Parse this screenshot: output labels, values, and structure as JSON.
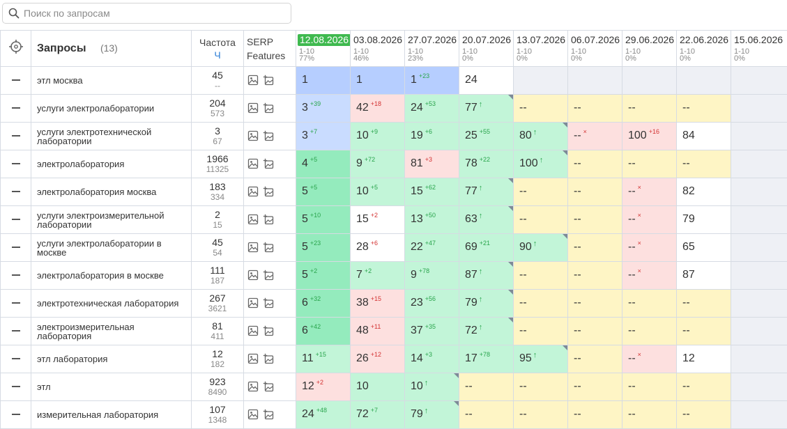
{
  "search": {
    "placeholder": "Поиск по запросам"
  },
  "header": {
    "title": "Запросы",
    "count": "(13)",
    "freq_label": "Частота",
    "freq_sub": "Ч",
    "serp_line1": "SERP",
    "serp_line2": "Features",
    "dates": [
      {
        "date": "12.08.2026",
        "range": "1-10",
        "pct": "77%",
        "active": true
      },
      {
        "date": "03.08.2026",
        "range": "1-10",
        "pct": "46%",
        "active": false
      },
      {
        "date": "27.07.2026",
        "range": "1-10",
        "pct": "23%",
        "active": false
      },
      {
        "date": "20.07.2026",
        "range": "1-10",
        "pct": "0%",
        "active": false
      },
      {
        "date": "13.07.2026",
        "range": "1-10",
        "pct": "0%",
        "active": false
      },
      {
        "date": "06.07.2026",
        "range": "1-10",
        "pct": "0%",
        "active": false
      },
      {
        "date": "29.06.2026",
        "range": "1-10",
        "pct": "0%",
        "active": false
      },
      {
        "date": "22.06.2026",
        "range": "1-10",
        "pct": "0%",
        "active": false
      },
      {
        "date": "15.06.2026",
        "range": "1-10",
        "pct": "0%",
        "active": false
      }
    ]
  },
  "colors": {
    "active_date": "#3fb94f",
    "blue": "#c9dcff",
    "green": "#c2f5d8",
    "red": "#fde0df",
    "yellow": "#fef5c5",
    "gray": "#eef0f5"
  },
  "icons": {
    "target": "crosshair-icon",
    "search": "search-icon",
    "serp1": "image-icon",
    "serp2": "images-plus-icon",
    "row_action": "minus-icon"
  },
  "rows": [
    {
      "query": "этл москва",
      "freq": "45",
      "freq2": "--",
      "cells": [
        {
          "v": "1",
          "bg": "blue2"
        },
        {
          "v": "1",
          "bg": "blue2"
        },
        {
          "v": "1",
          "d": "+23",
          "dir": "up",
          "bg": "blue2"
        },
        {
          "v": "24",
          "bg": "white"
        },
        {
          "bg": "gray"
        },
        {
          "bg": "gray"
        },
        {
          "bg": "gray"
        },
        {
          "bg": "gray"
        },
        {
          "bg": "gray"
        }
      ]
    },
    {
      "query": "услуги электролаборатории",
      "freq": "204",
      "freq2": "573",
      "cells": [
        {
          "v": "3",
          "d": "+39",
          "dir": "up",
          "bg": "blue"
        },
        {
          "v": "42",
          "d": "+18",
          "dir": "down",
          "bg": "red"
        },
        {
          "v": "24",
          "d": "+53",
          "dir": "up",
          "bg": "green"
        },
        {
          "v": "77",
          "d": "↑",
          "dir": "new",
          "bg": "green",
          "corner": true
        },
        {
          "v": "--",
          "bg": "yellow"
        },
        {
          "v": "--",
          "bg": "yellow"
        },
        {
          "v": "--",
          "bg": "yellow"
        },
        {
          "v": "--",
          "bg": "yellow"
        },
        {
          "bg": "gray"
        }
      ]
    },
    {
      "query": "услуги электротехнической лаборатории",
      "freq": "3",
      "freq2": "67",
      "cells": [
        {
          "v": "3",
          "d": "+7",
          "dir": "up",
          "bg": "blue"
        },
        {
          "v": "10",
          "d": "+9",
          "dir": "up",
          "bg": "green"
        },
        {
          "v": "19",
          "d": "+6",
          "dir": "up",
          "bg": "green"
        },
        {
          "v": "25",
          "d": "+55",
          "dir": "up",
          "bg": "green"
        },
        {
          "v": "80",
          "d": "↑",
          "dir": "new",
          "bg": "green",
          "corner": true
        },
        {
          "v": "--",
          "d": "×",
          "dir": "down",
          "bg": "red"
        },
        {
          "v": "100",
          "d": "+16",
          "dir": "down",
          "bg": "red"
        },
        {
          "v": "84",
          "bg": "white"
        },
        {
          "bg": "gray"
        }
      ]
    },
    {
      "query": "электролаборатория",
      "freq": "1966",
      "freq2": "11325",
      "cells": [
        {
          "v": "4",
          "d": "+5",
          "dir": "up",
          "bg": "green2"
        },
        {
          "v": "9",
          "d": "+72",
          "dir": "up",
          "bg": "green"
        },
        {
          "v": "81",
          "d": "+3",
          "dir": "down",
          "bg": "red"
        },
        {
          "v": "78",
          "d": "+22",
          "dir": "up",
          "bg": "green"
        },
        {
          "v": "100",
          "d": "↑",
          "dir": "new",
          "bg": "green",
          "corner": true
        },
        {
          "v": "--",
          "bg": "yellow"
        },
        {
          "v": "--",
          "bg": "yellow"
        },
        {
          "v": "--",
          "bg": "yellow"
        },
        {
          "bg": "gray"
        }
      ]
    },
    {
      "query": "электролаборатория москва",
      "freq": "183",
      "freq2": "334",
      "cells": [
        {
          "v": "5",
          "d": "+5",
          "dir": "up",
          "bg": "green2"
        },
        {
          "v": "10",
          "d": "+5",
          "dir": "up",
          "bg": "green"
        },
        {
          "v": "15",
          "d": "+62",
          "dir": "up",
          "bg": "green"
        },
        {
          "v": "77",
          "d": "↑",
          "dir": "new",
          "bg": "green",
          "corner": true
        },
        {
          "v": "--",
          "bg": "yellow"
        },
        {
          "v": "--",
          "bg": "yellow"
        },
        {
          "v": "--",
          "d": "×",
          "dir": "down",
          "bg": "red"
        },
        {
          "v": "82",
          "bg": "white"
        },
        {
          "bg": "gray"
        }
      ]
    },
    {
      "query": "услуги электроизмерительной лаборатории",
      "freq": "2",
      "freq2": "15",
      "cells": [
        {
          "v": "5",
          "d": "+10",
          "dir": "up",
          "bg": "green2"
        },
        {
          "v": "15",
          "d": "+2",
          "dir": "down",
          "bg": "white"
        },
        {
          "v": "13",
          "d": "+50",
          "dir": "up",
          "bg": "green"
        },
        {
          "v": "63",
          "d": "↑",
          "dir": "new",
          "bg": "green",
          "corner": true
        },
        {
          "v": "--",
          "bg": "yellow"
        },
        {
          "v": "--",
          "bg": "yellow"
        },
        {
          "v": "--",
          "d": "×",
          "dir": "down",
          "bg": "red"
        },
        {
          "v": "79",
          "bg": "white"
        },
        {
          "bg": "gray"
        }
      ]
    },
    {
      "query": "услуги электролаборатории в москве",
      "freq": "45",
      "freq2": "54",
      "cells": [
        {
          "v": "5",
          "d": "+23",
          "dir": "up",
          "bg": "green2"
        },
        {
          "v": "28",
          "d": "+6",
          "dir": "down",
          "bg": "white"
        },
        {
          "v": "22",
          "d": "+47",
          "dir": "up",
          "bg": "green"
        },
        {
          "v": "69",
          "d": "+21",
          "dir": "up",
          "bg": "green"
        },
        {
          "v": "90",
          "d": "↑",
          "dir": "new",
          "bg": "green",
          "corner": true
        },
        {
          "v": "--",
          "bg": "yellow"
        },
        {
          "v": "--",
          "d": "×",
          "dir": "down",
          "bg": "red"
        },
        {
          "v": "65",
          "bg": "white"
        },
        {
          "bg": "gray"
        }
      ]
    },
    {
      "query": "электролаборатория в москве",
      "freq": "111",
      "freq2": "187",
      "cells": [
        {
          "v": "5",
          "d": "+2",
          "dir": "up",
          "bg": "green2"
        },
        {
          "v": "7",
          "d": "+2",
          "dir": "up",
          "bg": "green"
        },
        {
          "v": "9",
          "d": "+78",
          "dir": "up",
          "bg": "green"
        },
        {
          "v": "87",
          "d": "↑",
          "dir": "new",
          "bg": "green",
          "corner": true
        },
        {
          "v": "--",
          "bg": "yellow"
        },
        {
          "v": "--",
          "bg": "yellow"
        },
        {
          "v": "--",
          "d": "×",
          "dir": "down",
          "bg": "red"
        },
        {
          "v": "87",
          "bg": "white"
        },
        {
          "bg": "gray"
        }
      ]
    },
    {
      "query": "электротехническая лаборатория",
      "freq": "267",
      "freq2": "3621",
      "cells": [
        {
          "v": "6",
          "d": "+32",
          "dir": "up",
          "bg": "green2"
        },
        {
          "v": "38",
          "d": "+15",
          "dir": "down",
          "bg": "red"
        },
        {
          "v": "23",
          "d": "+56",
          "dir": "up",
          "bg": "green"
        },
        {
          "v": "79",
          "d": "↑",
          "dir": "new",
          "bg": "green",
          "corner": true
        },
        {
          "v": "--",
          "bg": "yellow"
        },
        {
          "v": "--",
          "bg": "yellow"
        },
        {
          "v": "--",
          "bg": "yellow"
        },
        {
          "v": "--",
          "bg": "yellow"
        },
        {
          "bg": "gray"
        }
      ]
    },
    {
      "query": "электроизмерительная лаборатория",
      "freq": "81",
      "freq2": "411",
      "cells": [
        {
          "v": "6",
          "d": "+42",
          "dir": "up",
          "bg": "green2"
        },
        {
          "v": "48",
          "d": "+11",
          "dir": "down",
          "bg": "red"
        },
        {
          "v": "37",
          "d": "+35",
          "dir": "up",
          "bg": "green"
        },
        {
          "v": "72",
          "d": "↑",
          "dir": "new",
          "bg": "green",
          "corner": true
        },
        {
          "v": "--",
          "bg": "yellow"
        },
        {
          "v": "--",
          "bg": "yellow"
        },
        {
          "v": "--",
          "bg": "yellow"
        },
        {
          "v": "--",
          "bg": "yellow"
        },
        {
          "bg": "gray"
        }
      ]
    },
    {
      "query": "этл лаборатория",
      "freq": "12",
      "freq2": "182",
      "cells": [
        {
          "v": "11",
          "d": "+15",
          "dir": "up",
          "bg": "green"
        },
        {
          "v": "26",
          "d": "+12",
          "dir": "down",
          "bg": "red"
        },
        {
          "v": "14",
          "d": "+3",
          "dir": "up",
          "bg": "green"
        },
        {
          "v": "17",
          "d": "+78",
          "dir": "up",
          "bg": "green"
        },
        {
          "v": "95",
          "d": "↑",
          "dir": "new",
          "bg": "green",
          "corner": true
        },
        {
          "v": "--",
          "bg": "yellow"
        },
        {
          "v": "--",
          "d": "×",
          "dir": "down",
          "bg": "red"
        },
        {
          "v": "12",
          "bg": "white"
        },
        {
          "bg": "gray"
        }
      ]
    },
    {
      "query": "этл",
      "freq": "923",
      "freq2": "8490",
      "cells": [
        {
          "v": "12",
          "d": "+2",
          "dir": "down",
          "bg": "red"
        },
        {
          "v": "10",
          "bg": "green"
        },
        {
          "v": "10",
          "d": "↑",
          "dir": "new",
          "bg": "green",
          "corner": true
        },
        {
          "v": "--",
          "bg": "yellow"
        },
        {
          "v": "--",
          "bg": "yellow"
        },
        {
          "v": "--",
          "bg": "yellow"
        },
        {
          "v": "--",
          "bg": "yellow"
        },
        {
          "v": "--",
          "bg": "yellow"
        },
        {
          "bg": "gray"
        }
      ]
    },
    {
      "query": "измерительная лаборатория",
      "freq": "107",
      "freq2": "1348",
      "cells": [
        {
          "v": "24",
          "d": "+48",
          "dir": "up",
          "bg": "green"
        },
        {
          "v": "72",
          "d": "+7",
          "dir": "up",
          "bg": "green"
        },
        {
          "v": "79",
          "d": "↑",
          "dir": "new",
          "bg": "green",
          "corner": true
        },
        {
          "v": "--",
          "bg": "yellow"
        },
        {
          "v": "--",
          "bg": "yellow"
        },
        {
          "v": "--",
          "bg": "yellow"
        },
        {
          "v": "--",
          "bg": "yellow"
        },
        {
          "v": "--",
          "bg": "yellow"
        },
        {
          "bg": "gray"
        }
      ]
    }
  ]
}
